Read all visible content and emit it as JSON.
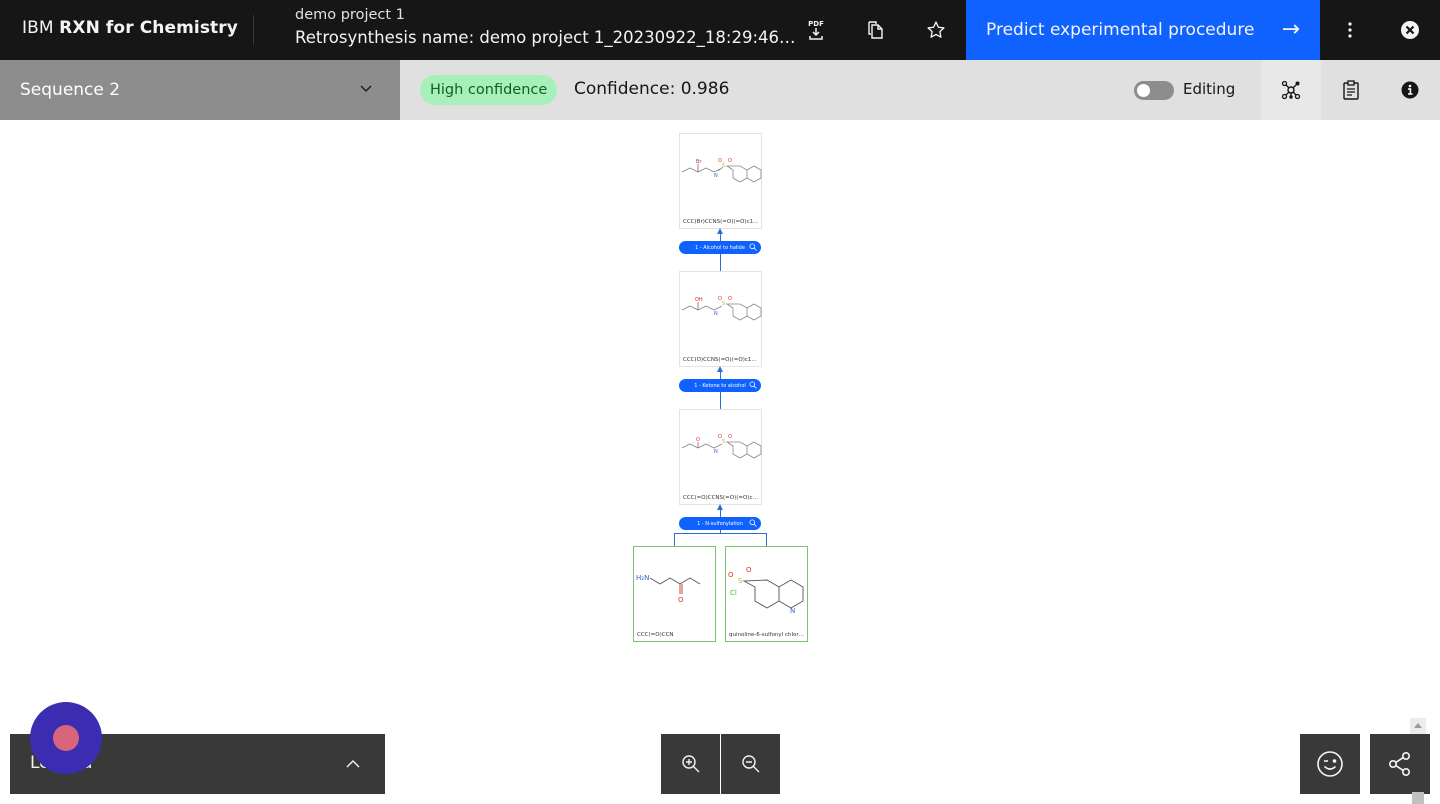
{
  "header": {
    "brand_prefix": "IBM",
    "brand_name": "RXN for Chemistry",
    "project_name": "demo project 1",
    "retrosynthesis_name": "Retrosynthesis name: demo project 1_20230922_18:29:46.8...",
    "icons": [
      "pdf-download-icon",
      "copy-icon",
      "star-icon",
      "overflow-menu-icon",
      "close-icon"
    ],
    "pdf_label": "PDF",
    "predict_button": "Predict experimental procedure",
    "predict_arrow": "→"
  },
  "subbar": {
    "sequence_label": "Sequence 2",
    "confidence_badge": "High confidence",
    "confidence_text": "Confidence: 0.986",
    "editing_label": "Editing",
    "editing_enabled": false,
    "colors": {
      "badge_bg": "#a7f0ba",
      "badge_text": "#0e6027",
      "accent": "#0f62fe"
    }
  },
  "tree": {
    "molecules": [
      {
        "smiles": "CCC(Br)CCNS(=O)(=O)c1ccc2n...",
        "substituent": "Br"
      },
      {
        "smiles": "CCC(O)CCNS(=O)(=O)c1ccc2nc...",
        "substituent": "OH"
      },
      {
        "smiles": "CCC(=O)CCNS(=O)(=O)c1ccc2...",
        "substituent": "O"
      }
    ],
    "reactions": [
      {
        "label": "1 - Alcohol to halide"
      },
      {
        "label": "1 - Ketone to alcohol"
      },
      {
        "label": "1 - N-sulfonylation"
      }
    ],
    "precursors": [
      {
        "smiles": "CCC(=O)CCN",
        "amine_label": "H₂N",
        "oxygen_label": "O"
      },
      {
        "smiles": "quinoline-6-sulfonyl chloride",
        "cl_label": "Cl",
        "n_label": "N",
        "o_label": "O"
      }
    ]
  },
  "footer": {
    "legend_label": "Legend",
    "zoom_in": "zoom-in-icon",
    "zoom_out": "zoom-out-icon",
    "feedback": "feedback-wink-icon",
    "share": "share-icon"
  }
}
